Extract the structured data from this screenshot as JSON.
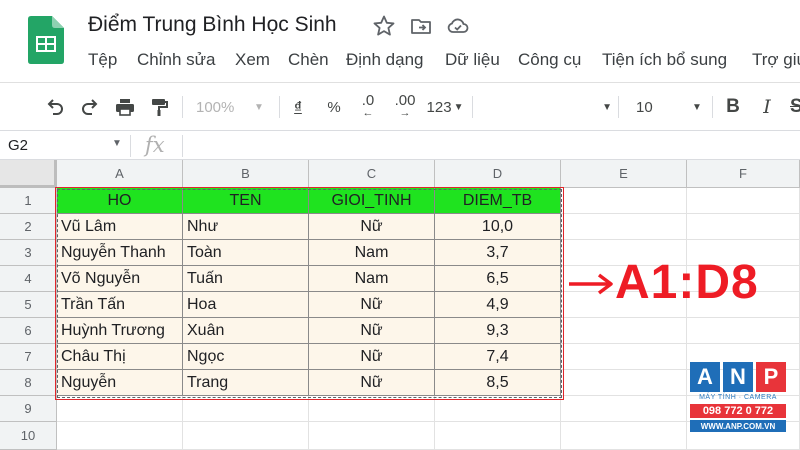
{
  "document": {
    "title": "Điểm Trung Bình Học Sinh",
    "menu": [
      "Tệp",
      "Chỉnh sửa",
      "Xem",
      "Chèn",
      "Định dạng",
      "Dữ liệu",
      "Công cụ",
      "Tiện ích bổ sung",
      "Trợ giú"
    ]
  },
  "toolbar": {
    "zoom": "100%",
    "currency": "₫",
    "percent": "%",
    "decimal_decrease": ".0",
    "decimal_increase": ".00",
    "number_format": "123",
    "font_size": "10",
    "bold": "B",
    "italic": "I"
  },
  "formula_bar": {
    "cell_ref": "G2",
    "fx": "fx"
  },
  "sheet": {
    "columns": [
      "A",
      "B",
      "C",
      "D",
      "E",
      "F"
    ],
    "rows": [
      "1",
      "2",
      "3",
      "4",
      "5",
      "6",
      "7",
      "8",
      "9",
      "10"
    ],
    "header": [
      "HO",
      "TEN",
      "GIOI_TINH",
      "DIEM_TB"
    ],
    "data": [
      [
        "Vũ Lâm",
        "Như",
        "Nữ",
        "10,0"
      ],
      [
        "Nguyễn Thanh",
        "Toàn",
        "Nam",
        "3,7"
      ],
      [
        "Võ Nguyễn",
        "Tuấn",
        "Nam",
        "6,5"
      ],
      [
        "Trần Tấn",
        "Hoa",
        "Nữ",
        "4,9"
      ],
      [
        "Huỳnh Trương",
        "Xuân",
        "Nữ",
        "9,3"
      ],
      [
        "Châu Thị",
        "Ngọc",
        "Nữ",
        "7,4"
      ],
      [
        "Nguyễn",
        "Trang",
        "Nữ",
        "8,5"
      ]
    ],
    "header_color": "#1fe31f",
    "data_fill_color": "#fdf6ea"
  },
  "annotation": {
    "arrow": "→",
    "range": "A1:D8",
    "color": "#ee1c25"
  },
  "watermark": {
    "letters": [
      "A",
      "N",
      "P"
    ],
    "tagline": "MÁY TÍNH · CAMERA",
    "phone": "098 772 0 772",
    "url": "WWW.ANP.COM.VN"
  }
}
